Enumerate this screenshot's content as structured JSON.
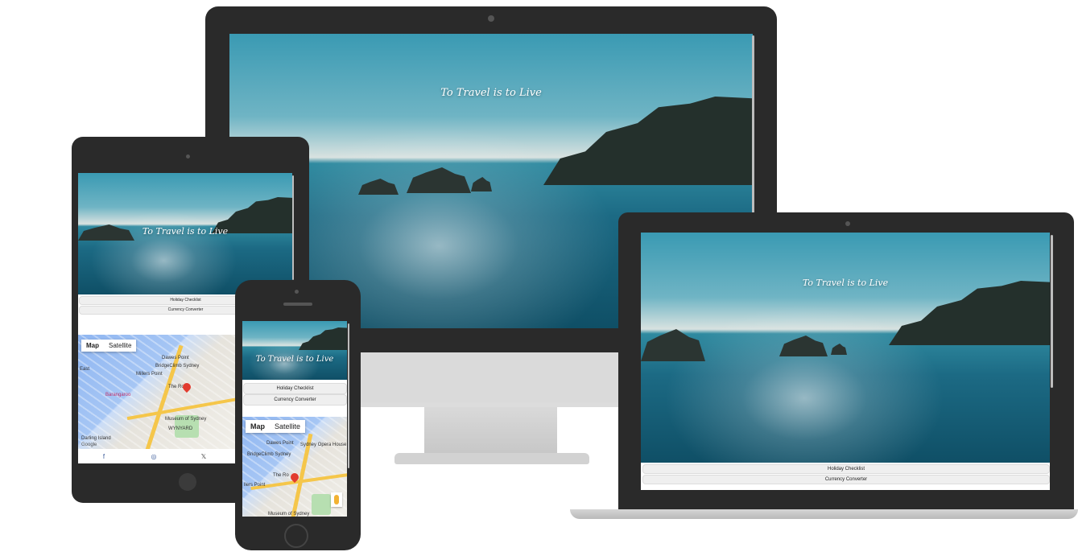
{
  "site": {
    "headline": "To Travel is to Live",
    "buttons": {
      "holiday_checklist": "Holiday Checklist",
      "currency_converter": "Currency Converter"
    }
  },
  "map": {
    "toggle": {
      "map": "Map",
      "satellite": "Satellite"
    },
    "labels": {
      "dawes_point": "Dawes Point",
      "bridgeclimb": "BridgeClimb Sydney",
      "sydney_opera_house": "Sydney Opera House",
      "the_rocks": "The Ro",
      "millers_point": "Millers Point",
      "millers_point_short": "llers Point",
      "museum_of_sydney": "Museum of Sydney",
      "barangaroo": "Barangaroo",
      "darling_island": "Darling Island",
      "wynyard": "WYNYARD",
      "google": "Google",
      "east": "East"
    }
  },
  "social": {
    "facebook": "f",
    "instagram": "◎",
    "x": "𝕏"
  },
  "colors": {
    "device_frame": "#2a2a2a",
    "map_pin": "#e23b2e"
  }
}
